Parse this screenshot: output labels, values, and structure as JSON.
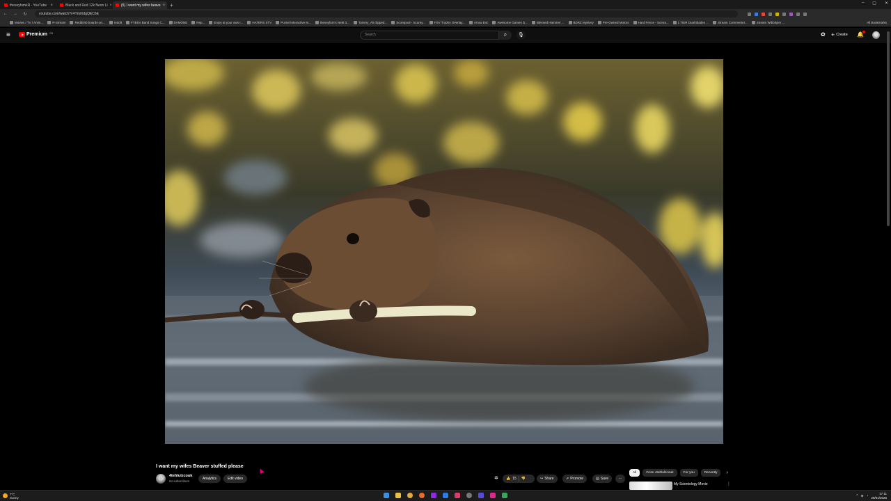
{
  "browser": {
    "tabs": [
      {
        "title": "theseyfumkR - YouTube",
        "active": false
      },
      {
        "title": "Black and Red 12k Neon Li",
        "active": false
      },
      {
        "title": "(5) I want my wifes beave",
        "active": true
      }
    ],
    "new_tab": "+",
    "window_controls": [
      "–",
      "▢",
      "✕"
    ],
    "url": "youtube.com/watch?v=HmiXdgQEC6E",
    "bookmarks": [
      "Movies / TV / Anim...",
      "R-Stream",
      "Reddit40 boards-on...",
      "reddit",
      "FTBSV Band Songs C...",
      "DAMONE",
      "Rep...",
      "Enjoy at your own r...",
      "HATERS STV",
      "Pursel Interactive M...",
      "theseyfum's Net6 3...",
      "Tommy_Ali clipped...",
      "Scorepool - Scorey...",
      "FSV Trophy Overlay...",
      "Arrow Esc",
      "Awesome Games D...",
      "Blessed Hammer ...",
      "BDRZ Mystery",
      "Pre-Owned Motors",
      "Hard Fence - Scena...",
      "1 TIER Dual Blades ...",
      "Stream Commenter...",
      "Stream Wibbityler ..."
    ],
    "all_bookmarks": "All Bookmarks"
  },
  "masthead": {
    "logo_text": "Premium",
    "logo_sup": "GB",
    "search_placeholder": "Search",
    "create_label": "Create"
  },
  "video": {
    "title": "I want my wifes Beaver stuffed please",
    "thumbnail_subject": "beaver-eating-stick-in-water"
  },
  "channel": {
    "name": "4tehlulzcouk",
    "subscribers": "94 subscribers",
    "analytics_label": "Analytics",
    "edit_label": "Edit video"
  },
  "actions": {
    "likes": "15",
    "share": "Share",
    "promote": "Promote",
    "save": "Save",
    "more": "···"
  },
  "sidebar": {
    "chips": [
      {
        "label": "All",
        "active": true
      },
      {
        "label": "From 4tehlulzcouk",
        "active": false
      },
      {
        "label": "For you",
        "active": false
      },
      {
        "label": "Recently",
        "active": false
      }
    ],
    "recommendation_title": "My Scientology Movie"
  },
  "taskbar": {
    "weather_temp": "7°C",
    "weather_desc": "Sunny",
    "time": "17:11",
    "date": "28/01/2025"
  },
  "colors": {
    "youtube_red": "#ff0000",
    "background": "#000000",
    "pill_bg": "#272727",
    "cursor": "#e4007c"
  }
}
